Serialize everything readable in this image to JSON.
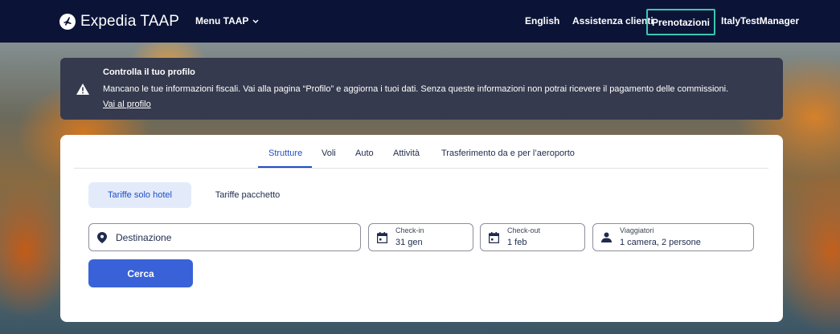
{
  "header": {
    "logo_text": "Expedia TAAP",
    "menu_label": "Menu TAAP",
    "language": "English",
    "support": "Assistenza clienti",
    "bookings": "Prenotazioni",
    "user": "ItalyTestManager",
    "bg_color": "#0b1437",
    "highlight_color": "#3ec7b0"
  },
  "alert": {
    "icon": "warning-icon",
    "title": "Controlla il tuo profilo",
    "message": "Mancano le tue informazioni fiscali. Vai alla pagina “Profilo” e aggiorna i tuoi dati. Senza queste informazioni non potrai ricevere il pagamento delle commissioni.",
    "link": "Vai al profilo"
  },
  "search": {
    "tabs": [
      {
        "label": "Strutture",
        "active": true
      },
      {
        "label": "Voli",
        "active": false
      },
      {
        "label": "Auto",
        "active": false
      },
      {
        "label": "Attività",
        "active": false
      },
      {
        "label": "Trasferimento da e per l’aeroporto",
        "active": false
      }
    ],
    "subtabs": [
      {
        "label": "Tariffe solo hotel",
        "active": true
      },
      {
        "label": "Tariffe pacchetto",
        "active": false
      }
    ],
    "destination": {
      "placeholder": "Destinazione",
      "icon": "location-pin-icon"
    },
    "checkin": {
      "label": "Check-in",
      "value": "31 gen",
      "icon": "calendar-icon"
    },
    "checkout": {
      "label": "Check-out",
      "value": "1 feb",
      "icon": "calendar-icon"
    },
    "travelers": {
      "label": "Viaggiatori",
      "value": "1 camera, 2 persone",
      "icon": "person-icon"
    },
    "submit": "Cerca",
    "accent_color": "#3a62d8"
  }
}
